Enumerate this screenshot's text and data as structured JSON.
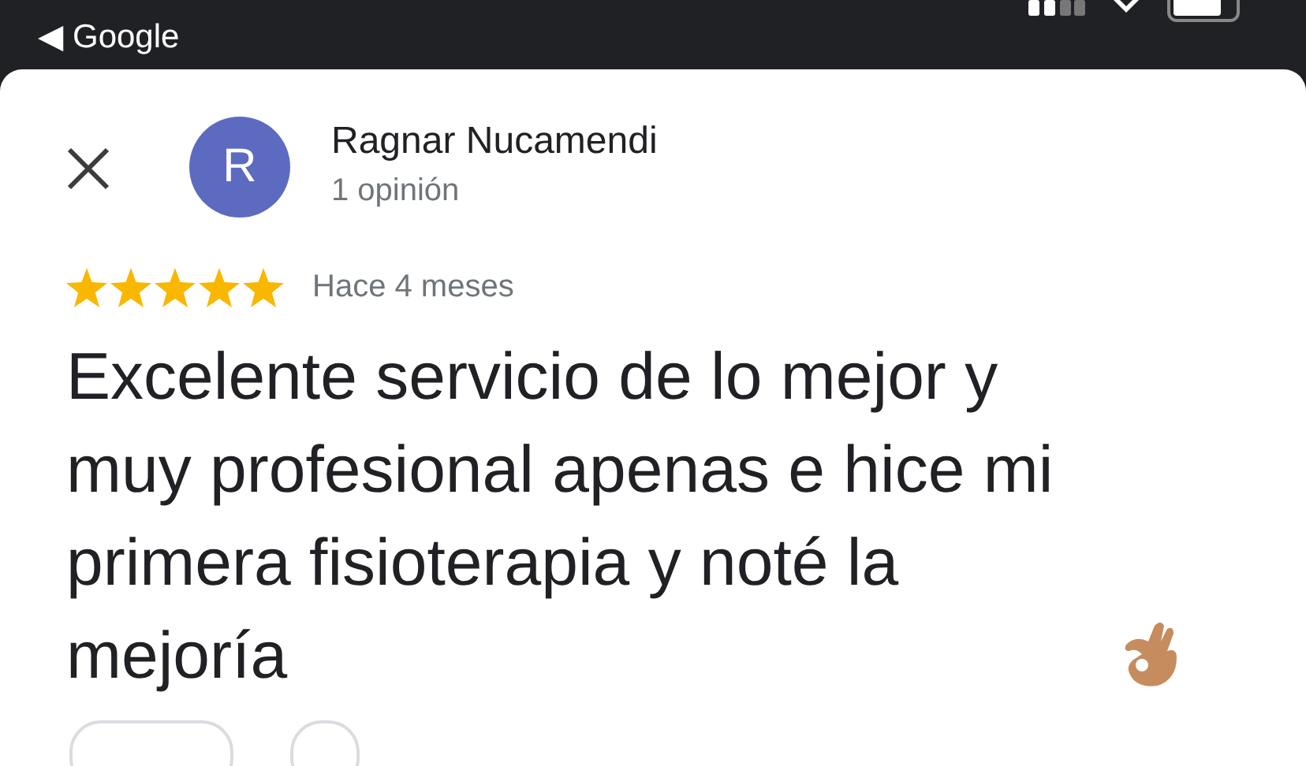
{
  "status_bar": {
    "back_arrow": "◀",
    "back_label": "Google"
  },
  "review": {
    "author": "Ragnar Nucamendi",
    "avatar_letter": "R",
    "review_count": "1 opinión",
    "stars": 5,
    "time": "Hace 4 meses",
    "text": "Excelente servicio de lo mejor y muy profesional apenas e hice mi primera fisioterapia y noté la mejoría"
  }
}
